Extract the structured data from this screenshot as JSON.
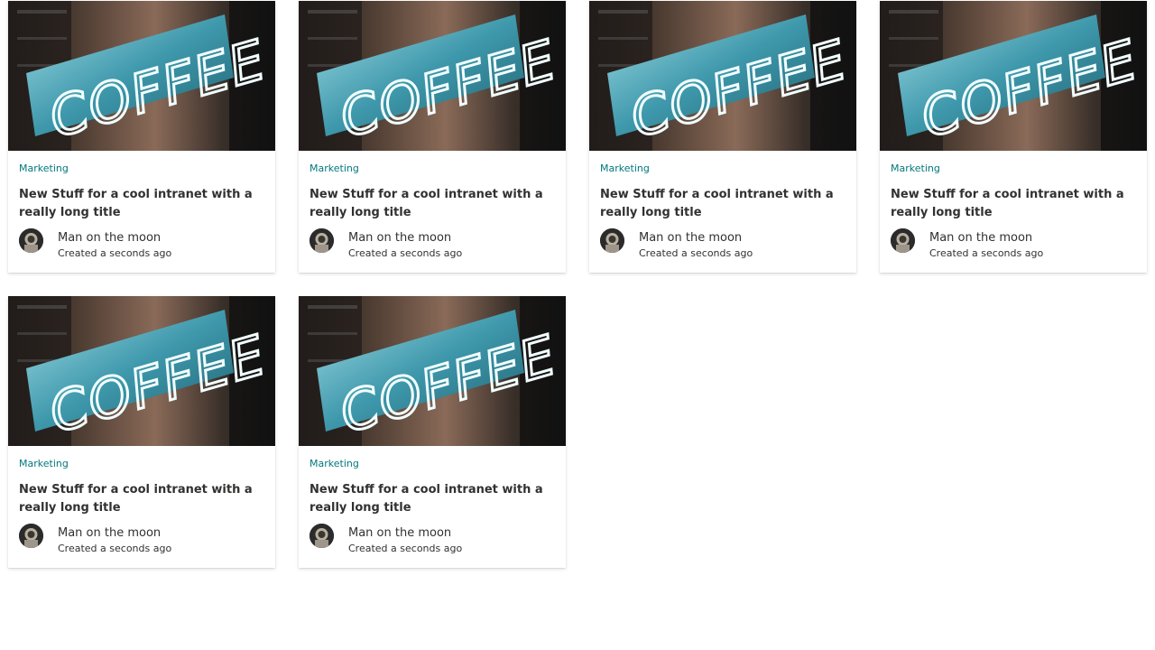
{
  "cards": [
    {
      "category": "Marketing",
      "title": "New Stuff for a cool intranet with a really long title",
      "image_text": "COFFEE",
      "author": "Man on the moon",
      "created": "Created a seconds ago"
    },
    {
      "category": "Marketing",
      "title": "New Stuff for a cool intranet with a really long title",
      "image_text": "COFFEE",
      "author": "Man on the moon",
      "created": "Created a seconds ago"
    },
    {
      "category": "Marketing",
      "title": "New Stuff for a cool intranet with a really long title",
      "image_text": "COFFEE",
      "author": "Man on the moon",
      "created": "Created a seconds ago"
    },
    {
      "category": "Marketing",
      "title": "New Stuff for a cool intranet with a really long title",
      "image_text": "COFFEE",
      "author": "Man on the moon",
      "created": "Created a seconds ago"
    },
    {
      "category": "Marketing",
      "title": "New Stuff for a cool intranet with a really long title",
      "image_text": "COFFEE",
      "author": "Man on the moon",
      "created": "Created a seconds ago"
    },
    {
      "category": "Marketing",
      "title": "New Stuff for a cool intranet with a really long title",
      "image_text": "COFFEE",
      "author": "Man on the moon",
      "created": "Created a seconds ago"
    }
  ],
  "colors": {
    "category": "#03787c",
    "text": "#323130",
    "neon": "#e8fbff",
    "sign": "#3a8fa0"
  }
}
